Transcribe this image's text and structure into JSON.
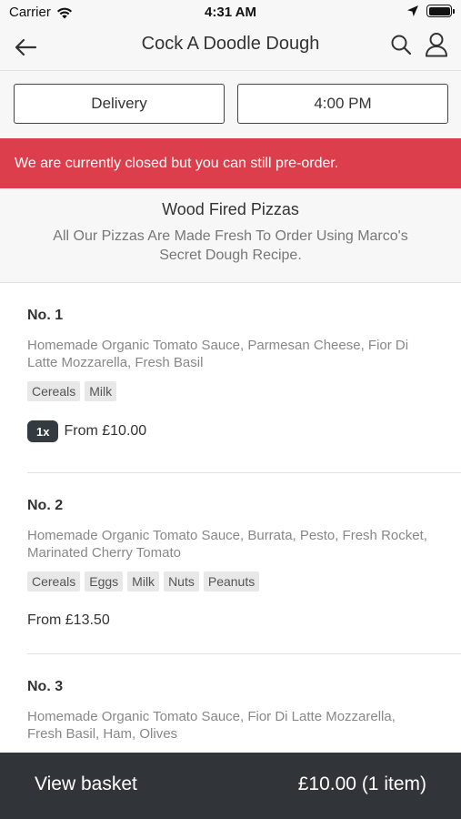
{
  "status_bar": {
    "carrier": "Carrier",
    "time": "4:31 AM"
  },
  "nav": {
    "title": "Cock A Doodle Dough",
    "back_icon": "arrow-left-icon",
    "search_icon": "search-icon",
    "account_icon": "user-icon"
  },
  "selectors": {
    "delivery_label": "Delivery",
    "time_label": "4:00 PM"
  },
  "alert": {
    "text": "We are currently closed but you can still pre-order.",
    "color": "#dc3f4b"
  },
  "section": {
    "title": "Wood Fired Pizzas",
    "description": "All Our Pizzas Are Made Fresh To Order Using Marco's Secret Dough Recipe."
  },
  "items": [
    {
      "name": "No. 1",
      "description": "Homemade Organic Tomato Sauce, Parmesan Cheese, Fior Di Latte Mozzarella, Fresh Basil",
      "tags": [
        "Cereals",
        "Milk"
      ],
      "quantity": "1x",
      "price": "From £10.00"
    },
    {
      "name": "No. 2",
      "description": "Homemade Organic Tomato Sauce, Burrata, Pesto, Fresh Rocket, Marinated Cherry Tomato",
      "tags": [
        "Cereals",
        "Eggs",
        "Milk",
        "Nuts",
        "Peanuts"
      ],
      "price": "From £13.50"
    },
    {
      "name": "No. 3",
      "description": "Homemade Organic Tomato Sauce, Fior Di Latte Mozzarella, Fresh Basil, Ham, Olives"
    }
  ],
  "basket": {
    "label": "View basket",
    "total": "£10.00 (1 item)",
    "background": "#31353a"
  }
}
